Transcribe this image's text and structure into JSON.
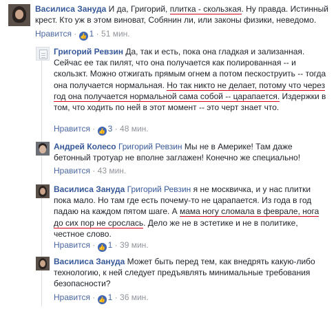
{
  "comments": [
    {
      "author": "Василиса Зануда",
      "text_before": " И да, Григорий, ",
      "underlined": "плитка - скользкая",
      "text_after": ". Ну правда. Истинный крест. Кто уж в этом виноват, Собянин ли, или законы физики, неведомо.",
      "like_label": "Нравится",
      "likes": "1",
      "time": "51 мин."
    },
    {
      "author": "Григорий Ревзин",
      "text_before": " Да, так и есть, пока она гладкая и зализанная. Сейчас ее так пилят, что она получается как полированная -- и скользкт. Можно отжигать прямым огнем а потом пескоструить -- тогда она получается нормальная. ",
      "underlined_1": "Но так никто не делает, потому что через год она получается нормальной сама собой -- царапается.",
      "text_after": " Издержки в том, что ходить по ней в этот момент -- это черт знает что.",
      "like_label": "Нравится",
      "likes": "3",
      "time": "48 мин."
    },
    {
      "author": "Андрей Колесо",
      "mention": "Григорий Ревзин",
      "text": " Мы не в Америке! Там даже бетонный тротуар не вполне заглажен! Конечно же специально!",
      "like_label": "Нравится",
      "time": "43 мин."
    },
    {
      "author": "Василиса Зануда",
      "mention": "Григорий Ревзин",
      "text_before": " я не москвичка, и у нас плитки пока мало. Но там где есть почему-то не царапается. Из года в год падаю на каждом пятом шаге. А ",
      "underlined": "мама ногу сломала в феврале, нога до сих пор не срослась",
      "text_after": ". Дело же не в эстетике и не в политике, честное слово.",
      "like_label": "Нравится",
      "likes": "1",
      "time": "39 мин."
    },
    {
      "author": "Василиса Зануда",
      "text": " Может быть перед тем, как внедрять какую-либо технологию, к ней следует предъявлять минимальные требования безопасности?",
      "like_label": "Нравится",
      "likes": "1",
      "time": "36 мин."
    }
  ],
  "icons": {
    "like": "thumbs-up-icon"
  },
  "colors": {
    "link": "#365899",
    "meta": "#90949c",
    "underline": "#d4001e",
    "like_badge": "#4267b2"
  }
}
